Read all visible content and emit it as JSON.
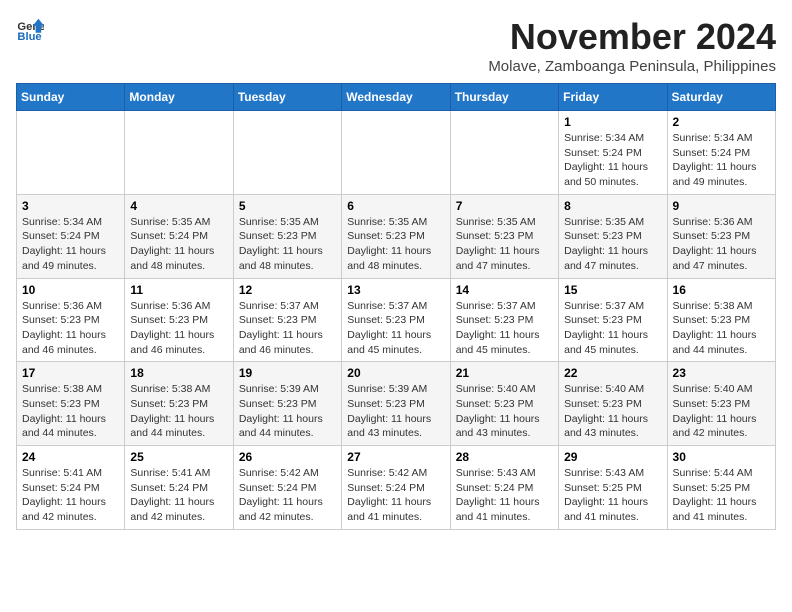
{
  "header": {
    "logo_general": "General",
    "logo_blue": "Blue",
    "month": "November 2024",
    "location": "Molave, Zamboanga Peninsula, Philippines"
  },
  "weekdays": [
    "Sunday",
    "Monday",
    "Tuesday",
    "Wednesday",
    "Thursday",
    "Friday",
    "Saturday"
  ],
  "weeks": [
    [
      {
        "day": "",
        "info": ""
      },
      {
        "day": "",
        "info": ""
      },
      {
        "day": "",
        "info": ""
      },
      {
        "day": "",
        "info": ""
      },
      {
        "day": "",
        "info": ""
      },
      {
        "day": "1",
        "info": "Sunrise: 5:34 AM\nSunset: 5:24 PM\nDaylight: 11 hours\nand 50 minutes."
      },
      {
        "day": "2",
        "info": "Sunrise: 5:34 AM\nSunset: 5:24 PM\nDaylight: 11 hours\nand 49 minutes."
      }
    ],
    [
      {
        "day": "3",
        "info": "Sunrise: 5:34 AM\nSunset: 5:24 PM\nDaylight: 11 hours\nand 49 minutes."
      },
      {
        "day": "4",
        "info": "Sunrise: 5:35 AM\nSunset: 5:24 PM\nDaylight: 11 hours\nand 48 minutes."
      },
      {
        "day": "5",
        "info": "Sunrise: 5:35 AM\nSunset: 5:23 PM\nDaylight: 11 hours\nand 48 minutes."
      },
      {
        "day": "6",
        "info": "Sunrise: 5:35 AM\nSunset: 5:23 PM\nDaylight: 11 hours\nand 48 minutes."
      },
      {
        "day": "7",
        "info": "Sunrise: 5:35 AM\nSunset: 5:23 PM\nDaylight: 11 hours\nand 47 minutes."
      },
      {
        "day": "8",
        "info": "Sunrise: 5:35 AM\nSunset: 5:23 PM\nDaylight: 11 hours\nand 47 minutes."
      },
      {
        "day": "9",
        "info": "Sunrise: 5:36 AM\nSunset: 5:23 PM\nDaylight: 11 hours\nand 47 minutes."
      }
    ],
    [
      {
        "day": "10",
        "info": "Sunrise: 5:36 AM\nSunset: 5:23 PM\nDaylight: 11 hours\nand 46 minutes."
      },
      {
        "day": "11",
        "info": "Sunrise: 5:36 AM\nSunset: 5:23 PM\nDaylight: 11 hours\nand 46 minutes."
      },
      {
        "day": "12",
        "info": "Sunrise: 5:37 AM\nSunset: 5:23 PM\nDaylight: 11 hours\nand 46 minutes."
      },
      {
        "day": "13",
        "info": "Sunrise: 5:37 AM\nSunset: 5:23 PM\nDaylight: 11 hours\nand 45 minutes."
      },
      {
        "day": "14",
        "info": "Sunrise: 5:37 AM\nSunset: 5:23 PM\nDaylight: 11 hours\nand 45 minutes."
      },
      {
        "day": "15",
        "info": "Sunrise: 5:37 AM\nSunset: 5:23 PM\nDaylight: 11 hours\nand 45 minutes."
      },
      {
        "day": "16",
        "info": "Sunrise: 5:38 AM\nSunset: 5:23 PM\nDaylight: 11 hours\nand 44 minutes."
      }
    ],
    [
      {
        "day": "17",
        "info": "Sunrise: 5:38 AM\nSunset: 5:23 PM\nDaylight: 11 hours\nand 44 minutes."
      },
      {
        "day": "18",
        "info": "Sunrise: 5:38 AM\nSunset: 5:23 PM\nDaylight: 11 hours\nand 44 minutes."
      },
      {
        "day": "19",
        "info": "Sunrise: 5:39 AM\nSunset: 5:23 PM\nDaylight: 11 hours\nand 44 minutes."
      },
      {
        "day": "20",
        "info": "Sunrise: 5:39 AM\nSunset: 5:23 PM\nDaylight: 11 hours\nand 43 minutes."
      },
      {
        "day": "21",
        "info": "Sunrise: 5:40 AM\nSunset: 5:23 PM\nDaylight: 11 hours\nand 43 minutes."
      },
      {
        "day": "22",
        "info": "Sunrise: 5:40 AM\nSunset: 5:23 PM\nDaylight: 11 hours\nand 43 minutes."
      },
      {
        "day": "23",
        "info": "Sunrise: 5:40 AM\nSunset: 5:23 PM\nDaylight: 11 hours\nand 42 minutes."
      }
    ],
    [
      {
        "day": "24",
        "info": "Sunrise: 5:41 AM\nSunset: 5:24 PM\nDaylight: 11 hours\nand 42 minutes."
      },
      {
        "day": "25",
        "info": "Sunrise: 5:41 AM\nSunset: 5:24 PM\nDaylight: 11 hours\nand 42 minutes."
      },
      {
        "day": "26",
        "info": "Sunrise: 5:42 AM\nSunset: 5:24 PM\nDaylight: 11 hours\nand 42 minutes."
      },
      {
        "day": "27",
        "info": "Sunrise: 5:42 AM\nSunset: 5:24 PM\nDaylight: 11 hours\nand 41 minutes."
      },
      {
        "day": "28",
        "info": "Sunrise: 5:43 AM\nSunset: 5:24 PM\nDaylight: 11 hours\nand 41 minutes."
      },
      {
        "day": "29",
        "info": "Sunrise: 5:43 AM\nSunset: 5:25 PM\nDaylight: 11 hours\nand 41 minutes."
      },
      {
        "day": "30",
        "info": "Sunrise: 5:44 AM\nSunset: 5:25 PM\nDaylight: 11 hours\nand 41 minutes."
      }
    ]
  ]
}
